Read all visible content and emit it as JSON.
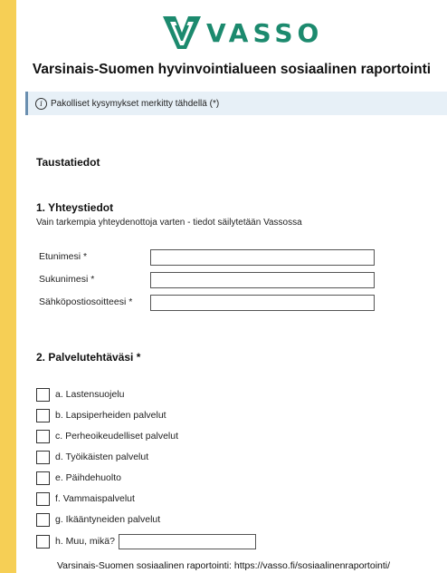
{
  "brand": {
    "name": "VASSO",
    "color": "#1c8a6e",
    "icon": "vasso-logo-icon"
  },
  "subtitle": "Varsinais-Suomen hyvinvointialueen sosiaalinen raportointi",
  "info": {
    "icon": "info-icon",
    "text": "Pakolliset kysymykset merkitty tähdellä (*)"
  },
  "section_title": "Taustatiedot",
  "q1": {
    "title": "1. Yhteystiedot",
    "description": "Vain tarkempia yhteydenottoja varten - tiedot säilytetään Vassossa",
    "fields": [
      {
        "label": "Etunimesi",
        "required": "*",
        "value": ""
      },
      {
        "label": "Sukunimesi",
        "required": "*",
        "value": ""
      },
      {
        "label": "Sähköpostiosoitteesi",
        "required": "*",
        "value": ""
      }
    ]
  },
  "q2": {
    "title": "2. Palvelutehtäväsi *",
    "options": [
      "a. Lastensuojelu",
      "b. Lapsiperheiden palvelut",
      "c. Perheoikeudelliset palvelut",
      "d. Työikäisten palvelut",
      "e. Päihdehuolto",
      "f. Vammaispalvelut",
      "g. Ikääntyneiden palvelut",
      "h. Muu, mikä?"
    ],
    "other_value": ""
  },
  "footer": "Varsinais-Suomen sosiaalinen raportointi: https://vasso.fi/sosiaalinenraportointi/"
}
